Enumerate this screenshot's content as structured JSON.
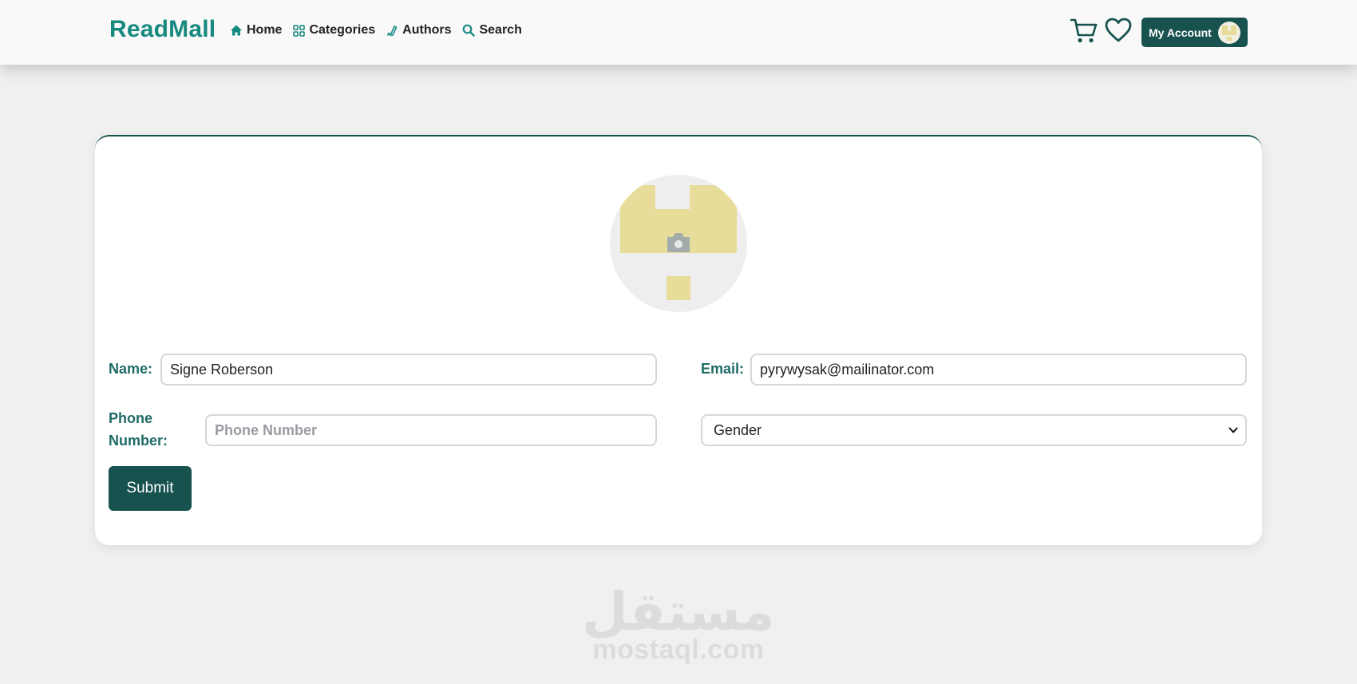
{
  "colors": {
    "brand": "#178a80",
    "primary": "#17524f",
    "label": "#1f6b66",
    "background": "#f0f0f0"
  },
  "header": {
    "brand": "ReadMall",
    "nav": [
      {
        "label": "Home",
        "icon": "home-icon"
      },
      {
        "label": "Categories",
        "icon": "grid-icon"
      },
      {
        "label": "Authors",
        "icon": "pen-icon"
      },
      {
        "label": "Search",
        "icon": "search-icon"
      }
    ],
    "cart_icon": "cart-icon",
    "wishlist_icon": "heart-icon",
    "account_label": "My Account"
  },
  "profile_form": {
    "avatar_icon": "camera-icon",
    "name_label": "Name:",
    "name_value": "Signe Roberson",
    "email_label": "Email:",
    "email_value": "pyrywysak@mailinator.com",
    "phone_label_line1": "Phone",
    "phone_label_line2": "Number:",
    "phone_placeholder": "Phone Number",
    "gender_selected": "Gender",
    "submit_label": "Submit"
  },
  "watermark": {
    "arabic": "مستقل",
    "latin": "mostaql.com"
  }
}
